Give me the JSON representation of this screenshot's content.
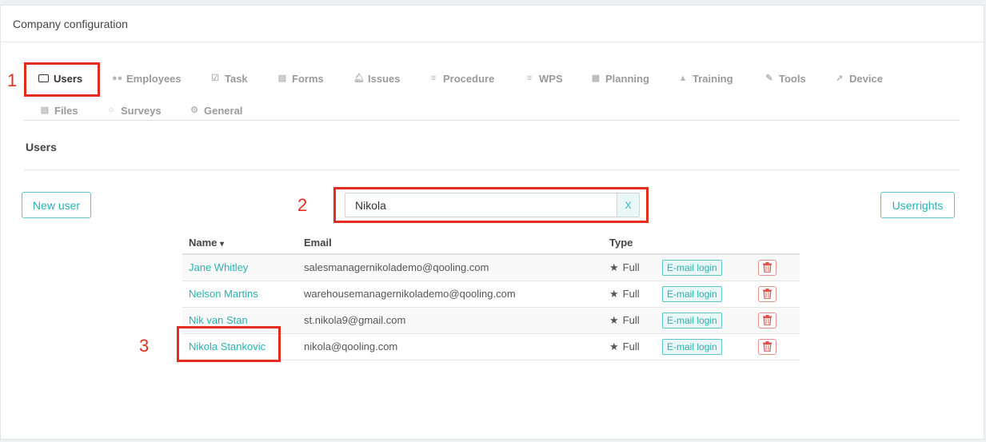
{
  "panel": {
    "title": "Company configuration"
  },
  "tabs": [
    {
      "label": "Users",
      "icon": "id-card-icon",
      "active": true
    },
    {
      "label": "Employees",
      "icon": "users-icon"
    },
    {
      "label": "Task",
      "icon": "checkbox-icon"
    },
    {
      "label": "Forms",
      "icon": "document-icon"
    },
    {
      "label": "Issues",
      "icon": "bell-icon"
    },
    {
      "label": "Procedure",
      "icon": "list-icon"
    },
    {
      "label": "WPS",
      "icon": "list-icon"
    },
    {
      "label": "Planning",
      "icon": "calendar-icon"
    },
    {
      "label": "Training",
      "icon": "graduation-cap-icon"
    },
    {
      "label": "Tools",
      "icon": "wrench-icon"
    },
    {
      "label": "Device",
      "icon": "rocket-icon"
    },
    {
      "label": "Files",
      "icon": "file-icon"
    },
    {
      "label": "Surveys",
      "icon": "chat-bubble-icon"
    },
    {
      "label": "General",
      "icon": "gear-icon"
    }
  ],
  "section": {
    "title": "Users"
  },
  "toolbar": {
    "new_user_label": "New user",
    "userrights_label": "Userrights"
  },
  "search": {
    "value": "Nikola",
    "placeholder": "",
    "clear_label": "X"
  },
  "table": {
    "columns": {
      "name": "Name",
      "email": "Email",
      "type": "Type"
    },
    "sort_indicator": "▾",
    "rows": [
      {
        "name": "Jane Whitley",
        "email": "salesmanagernikolademo@qooling.com",
        "type": "Full",
        "login": "E-mail login"
      },
      {
        "name": "Nelson Martins",
        "email": "warehousemanagernikolademo@qooling.com",
        "type": "Full",
        "login": "E-mail login"
      },
      {
        "name": "Nik van Stan",
        "email": "st.nikola9@gmail.com",
        "type": "Full",
        "login": "E-mail login"
      },
      {
        "name": "Nikola Stankovic",
        "email": "nikola@qooling.com",
        "type": "Full",
        "login": "E-mail login"
      }
    ]
  },
  "annotations": {
    "one": "1",
    "two": "2",
    "three": "3"
  },
  "colors": {
    "accent": "#2bb1b1",
    "annotation": "#e32d20",
    "danger": "#d9534f"
  }
}
